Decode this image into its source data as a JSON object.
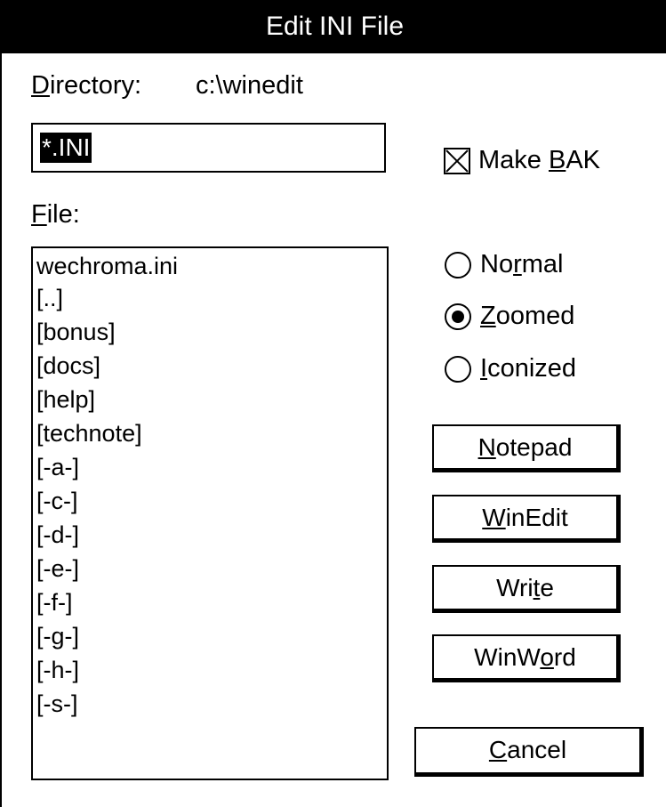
{
  "dialog": {
    "title": "Edit INI File",
    "directory_label_hotkey": "D",
    "directory_label_rest": "irectory:",
    "directory_value": "c:\\winedit",
    "filter_value": "*.INI",
    "make_bak": {
      "checked": true,
      "pre": "Make ",
      "hotkey": "B",
      "post": "AK"
    },
    "file_label_hotkey": "F",
    "file_label_rest": "ile:",
    "files": [
      "wechroma.ini",
      "[..]",
      "[bonus]",
      "[docs]",
      "[help]",
      "[technote]",
      "[-a-]",
      "[-c-]",
      "[-d-]",
      "[-e-]",
      "[-f-]",
      "[-g-]",
      "[-h-]",
      "[-s-]"
    ],
    "window_state": {
      "selected": "Zoomed",
      "normal": {
        "pre": "No",
        "hotkey": "r",
        "post": "mal"
      },
      "zoomed": {
        "pre": "",
        "hotkey": "Z",
        "post": "oomed"
      },
      "iconized": {
        "pre": "",
        "hotkey": "I",
        "post": "conized"
      }
    },
    "buttons": {
      "notepad": {
        "pre": "",
        "hotkey": "N",
        "post": "otepad"
      },
      "winedit": {
        "pre": "",
        "hotkey": "W",
        "post": "inEdit"
      },
      "write": {
        "pre": "Wri",
        "hotkey": "t",
        "post": "e"
      },
      "winword": {
        "pre": "WinW",
        "hotkey": "o",
        "post": "rd"
      },
      "cancel": {
        "pre": "",
        "hotkey": "C",
        "post": "ancel"
      }
    }
  }
}
